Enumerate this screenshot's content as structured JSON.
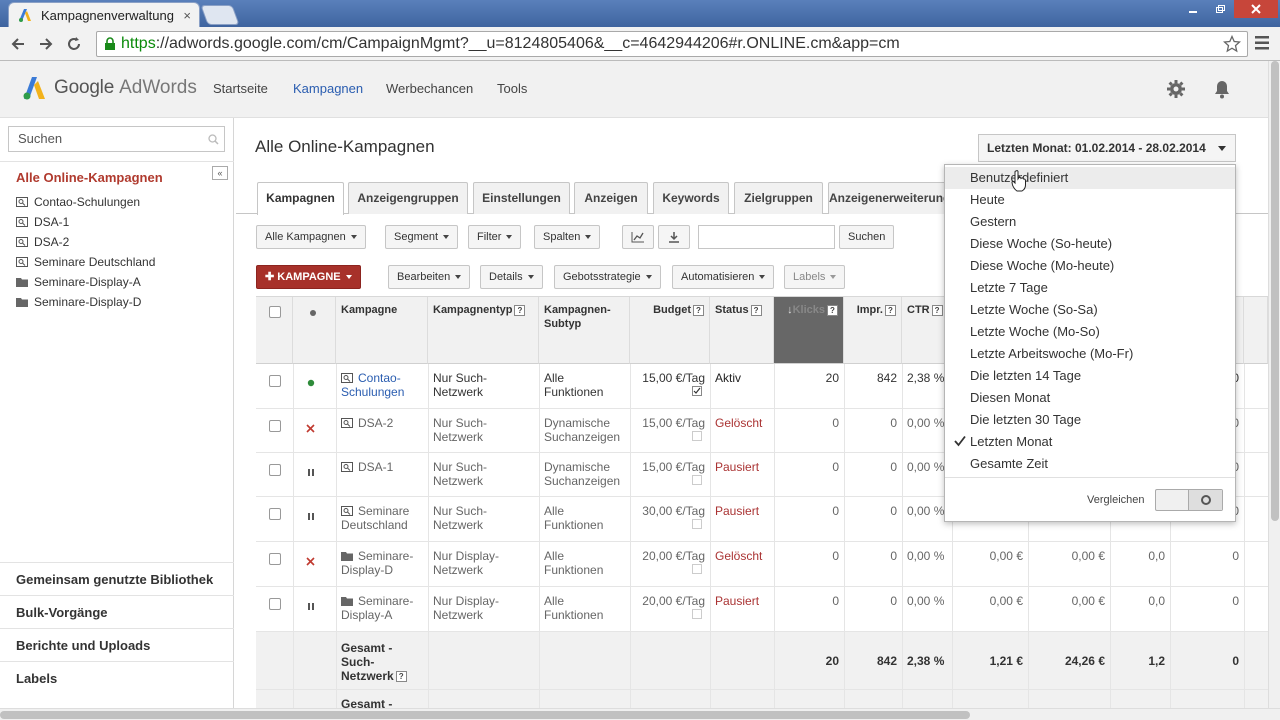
{
  "browser": {
    "tab_title": "Kampagnenverwaltung",
    "tab_close": "×",
    "url_https": "https",
    "url_rest": "://adwords.google.com/cm/CampaignMgmt?__u=8124805406&__c=4642944206#r.ONLINE.cm&app=cm"
  },
  "app": {
    "brand": "Google",
    "product": "AdWords",
    "nav": [
      "Startseite",
      "Kampagnen",
      "Werbechancen",
      "Tools"
    ]
  },
  "sidebar": {
    "search_placeholder": "Suchen",
    "collapse": "«",
    "all_campaigns": "Alle Online-Kampagnen",
    "campaigns": [
      {
        "name": "Contao-Schulungen",
        "icon": "search-campaign-icon"
      },
      {
        "name": "DSA-1",
        "icon": "search-campaign-icon"
      },
      {
        "name": "DSA-2",
        "icon": "search-campaign-icon"
      },
      {
        "name": "Seminare Deutschland",
        "icon": "search-campaign-icon"
      },
      {
        "name": "Seminare-Display-A",
        "icon": "folder-icon"
      },
      {
        "name": "Seminare-Display-D",
        "icon": "folder-icon"
      }
    ],
    "bottom_links": [
      "Gemeinsam genutzte Bibliothek",
      "Bulk-Vorgänge",
      "Berichte und Uploads",
      "Labels"
    ]
  },
  "main": {
    "title": "Alle Online-Kampagnen",
    "date_range": "Letzten Monat: 01.02.2014 - 28.02.2014",
    "tabs": [
      "Kampagnen",
      "Anzeigengruppen",
      "Einstellungen",
      "Anzeigen",
      "Keywords",
      "Zielgruppen",
      "Anzeigenerweiterungen"
    ],
    "filters": {
      "all_campaigns": "Alle Kampagnen",
      "segment": "Segment",
      "filter": "Filter",
      "columns": "Spalten",
      "search": "Suchen"
    },
    "actions": {
      "new_campaign": "KAMPAGNE",
      "edit": "Bearbeiten",
      "details": "Details",
      "bid_strategy": "Gebotsstrategie",
      "automate": "Automatisieren",
      "labels": "Labels"
    }
  },
  "table": {
    "headers": {
      "campaign": "Kampagne",
      "type": "Kampagnentyp",
      "subtype": "Kampagnen-Subtyp",
      "budget": "Budget",
      "status": "Status",
      "clicks": "Klicks",
      "impr": "Impr.",
      "ctr": "CTR",
      "help": "?"
    },
    "rows": [
      {
        "status_icon": "green-dot-icon",
        "campaign": "Contao-Schulungen",
        "type": "Nur Such-Netzwerk",
        "subtype": "Alle Funktionen",
        "budget": "15,00 €/Tag",
        "status": "Aktiv",
        "clicks": "20",
        "impr": "842",
        "ctr": "2,38 %",
        "c4": "",
        "c5": "",
        "c6": "",
        "c7": "0"
      },
      {
        "status_icon": "red-x-icon",
        "campaign": "DSA-2",
        "type": "Nur Such-Netzwerk",
        "subtype": "Dynamische Suchanzeigen",
        "budget": "15,00 €/Tag",
        "status": "Gelöscht",
        "clicks": "0",
        "impr": "0",
        "ctr": "0,00 %",
        "c4": "",
        "c5": "",
        "c6": "",
        "c7": "0"
      },
      {
        "status_icon": "pause-icon",
        "campaign": "DSA-1",
        "type": "Nur Such-Netzwerk",
        "subtype": "Dynamische Suchanzeigen",
        "budget": "15,00 €/Tag",
        "status": "Pausiert",
        "clicks": "0",
        "impr": "0",
        "ctr": "0,00 %",
        "c4": "",
        "c5": "",
        "c6": "",
        "c7": "0"
      },
      {
        "status_icon": "pause-icon",
        "campaign": "Seminare Deutschland",
        "type": "Nur Such-Netzwerk",
        "subtype": "Alle Funktionen",
        "budget": "30,00 €/Tag",
        "status": "Pausiert",
        "clicks": "0",
        "impr": "0",
        "ctr": "0,00 %",
        "c4": "",
        "c5": "",
        "c6": "",
        "c7": "0"
      },
      {
        "status_icon": "red-x-icon",
        "campaign": "Seminare-Display-D",
        "type": "Nur Display-Netzwerk",
        "subtype": "Alle Funktionen",
        "budget": "20,00 €/Tag",
        "status": "Gelöscht",
        "clicks": "0",
        "impr": "0",
        "ctr": "0,00 %",
        "c4": "0,00 €",
        "c5": "0,00 €",
        "c6": "0,0",
        "c7": "0"
      },
      {
        "status_icon": "pause-icon",
        "campaign": "Seminare-Display-A",
        "type": "Nur Display-Netzwerk",
        "subtype": "Alle Funktionen",
        "budget": "20,00 €/Tag",
        "status": "Pausiert",
        "clicks": "0",
        "impr": "0",
        "ctr": "0,00 %",
        "c4": "0,00 €",
        "c5": "0,00 €",
        "c6": "0,0",
        "c7": "0"
      }
    ],
    "totals": [
      {
        "label": "Gesamt - Such-Netzwerk",
        "clicks": "20",
        "impr": "842",
        "ctr": "2,38 %",
        "c4": "1,21 €",
        "c5": "24,26 €",
        "c6": "1,2",
        "c7": "0"
      },
      {
        "label": "Gesamt -"
      }
    ]
  },
  "dropdown": {
    "items": [
      "Benutzerdefiniert",
      "Heute",
      "Gestern",
      "Diese Woche (So-heute)",
      "Diese Woche (Mo-heute)",
      "Letzte 7 Tage",
      "Letzte Woche (So-Sa)",
      "Letzte Woche (Mo-So)",
      "Letzte Arbeitswoche (Mo-Fr)",
      "Die letzten 14 Tage",
      "Diesen Monat",
      "Die letzten 30 Tage",
      "Letzten Monat",
      "Gesamte Zeit"
    ],
    "selected": "Letzten Monat",
    "compare_label": "Vergleichen"
  },
  "colors": {
    "accent": "#2a5db0",
    "brand_red": "#a7312a",
    "deleted": "#aa3333"
  }
}
